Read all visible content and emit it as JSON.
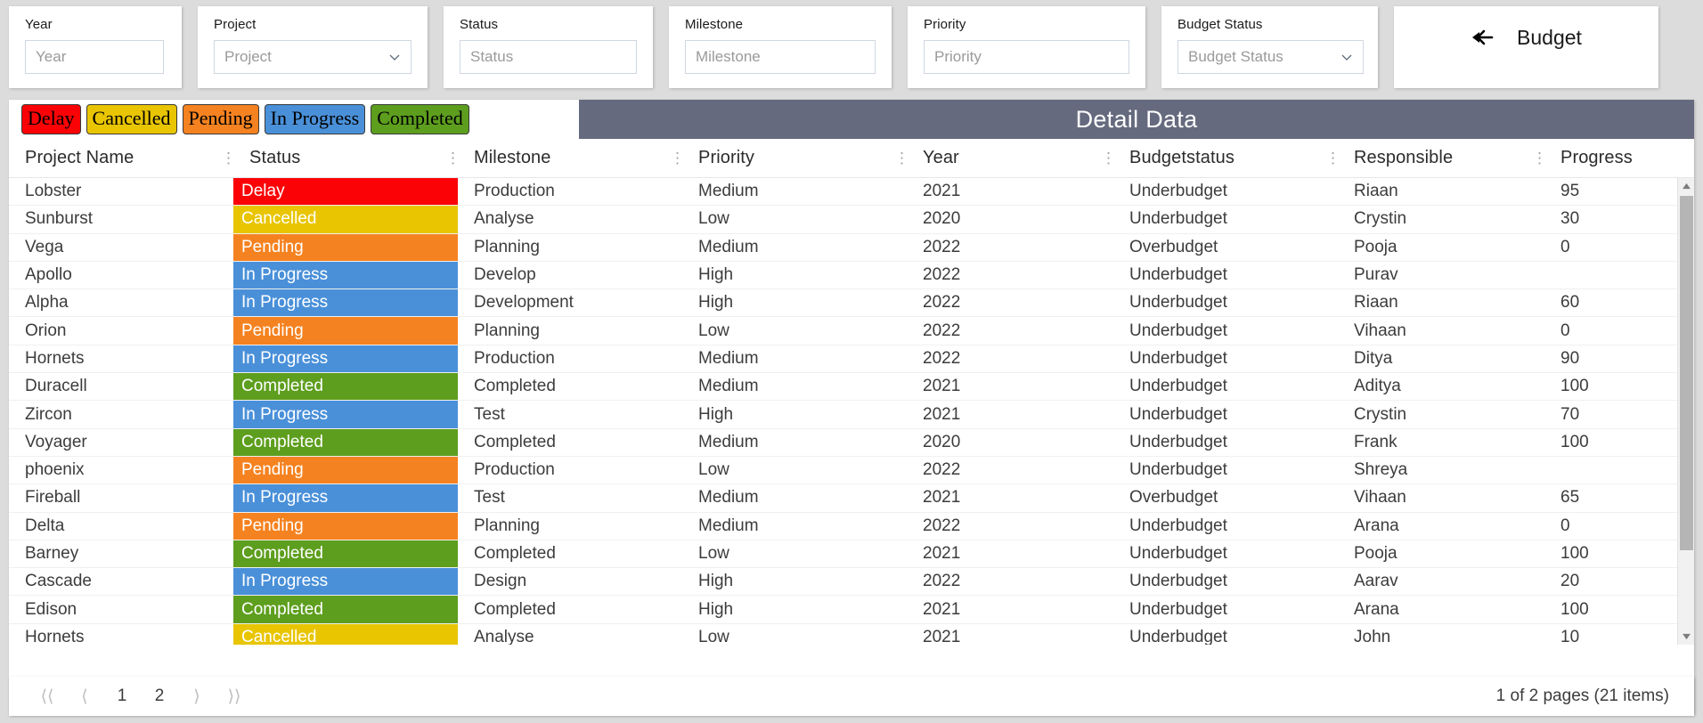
{
  "filters": [
    {
      "id": "year",
      "label": "Year",
      "placeholder": "Year",
      "value": "",
      "type": "text"
    },
    {
      "id": "project",
      "label": "Project",
      "placeholder": "Project",
      "value": "",
      "type": "select"
    },
    {
      "id": "status",
      "label": "Status",
      "placeholder": "Status",
      "value": "",
      "type": "text"
    },
    {
      "id": "milestone",
      "label": "Milestone",
      "placeholder": "Milestone",
      "value": "",
      "type": "text"
    },
    {
      "id": "priority",
      "label": "Priority",
      "placeholder": "Priority",
      "value": "",
      "type": "text"
    },
    {
      "id": "budgetstatus",
      "label": "Budget Status",
      "placeholder": "Budget Status",
      "value": "",
      "type": "select"
    }
  ],
  "budget_button": {
    "label": "Budget",
    "icon": "arrow-left-icon"
  },
  "legend": [
    {
      "label": "Delay",
      "color": "#fb0306"
    },
    {
      "label": "Cancelled",
      "color": "#e8c500"
    },
    {
      "label": "Pending",
      "color": "#f58220"
    },
    {
      "label": "In Progress",
      "color": "#4a90d9"
    },
    {
      "label": "Completed",
      "color": "#5d9e1e"
    }
  ],
  "detail_title": "Detail Data",
  "grid": {
    "columns": [
      "Project Name",
      "Status",
      "Milestone",
      "Priority",
      "Year",
      "Budgetstatus",
      "Responsible",
      "Progress"
    ],
    "rows": [
      {
        "project": "Lobster",
        "status": "Delay",
        "milestone": "Production",
        "priority": "Medium",
        "year": "2021",
        "budgetstatus": "Underbudget",
        "responsible": "Riaan",
        "progress": "95"
      },
      {
        "project": "Sunburst",
        "status": "Cancelled",
        "milestone": "Analyse",
        "priority": "Low",
        "year": "2020",
        "budgetstatus": "Underbudget",
        "responsible": "Crystin",
        "progress": "30"
      },
      {
        "project": "Vega",
        "status": "Pending",
        "milestone": "Planning",
        "priority": "Medium",
        "year": "2022",
        "budgetstatus": "Overbudget",
        "responsible": "Pooja",
        "progress": "0"
      },
      {
        "project": "Apollo",
        "status": "In Progress",
        "milestone": "Develop",
        "priority": "High",
        "year": "2022",
        "budgetstatus": "Underbudget",
        "responsible": "Purav",
        "progress": ""
      },
      {
        "project": "Alpha",
        "status": "In Progress",
        "milestone": "Development",
        "priority": "High",
        "year": "2022",
        "budgetstatus": "Underbudget",
        "responsible": "Riaan",
        "progress": "60"
      },
      {
        "project": "Orion",
        "status": "Pending",
        "milestone": "Planning",
        "priority": "Low",
        "year": "2022",
        "budgetstatus": "Underbudget",
        "responsible": "Vihaan",
        "progress": "0"
      },
      {
        "project": "Hornets",
        "status": "In Progress",
        "milestone": "Production",
        "priority": "Medium",
        "year": "2022",
        "budgetstatus": "Underbudget",
        "responsible": "Ditya",
        "progress": "90"
      },
      {
        "project": "Duracell",
        "status": "Completed",
        "milestone": "Completed",
        "priority": "Medium",
        "year": "2021",
        "budgetstatus": "Underbudget",
        "responsible": "Aditya",
        "progress": "100"
      },
      {
        "project": "Zircon",
        "status": "In Progress",
        "milestone": "Test",
        "priority": "High",
        "year": "2021",
        "budgetstatus": "Underbudget",
        "responsible": "Crystin",
        "progress": "70"
      },
      {
        "project": "Voyager",
        "status": "Completed",
        "milestone": "Completed",
        "priority": "Medium",
        "year": "2020",
        "budgetstatus": "Underbudget",
        "responsible": "Frank",
        "progress": "100"
      },
      {
        "project": "phoenix",
        "status": "Pending",
        "milestone": "Production",
        "priority": "Low",
        "year": "2022",
        "budgetstatus": "Underbudget",
        "responsible": "Shreya",
        "progress": ""
      },
      {
        "project": "Fireball",
        "status": "In Progress",
        "milestone": "Test",
        "priority": "Medium",
        "year": "2021",
        "budgetstatus": "Overbudget",
        "responsible": "Vihaan",
        "progress": "65"
      },
      {
        "project": "Delta",
        "status": "Pending",
        "milestone": "Planning",
        "priority": "Medium",
        "year": "2022",
        "budgetstatus": "Underbudget",
        "responsible": "Arana",
        "progress": "0"
      },
      {
        "project": "Barney",
        "status": "Completed",
        "milestone": "Completed",
        "priority": "Low",
        "year": "2021",
        "budgetstatus": "Underbudget",
        "responsible": "Pooja",
        "progress": "100"
      },
      {
        "project": "Cascade",
        "status": "In Progress",
        "milestone": "Design",
        "priority": "High",
        "year": "2022",
        "budgetstatus": "Underbudget",
        "responsible": "Aarav",
        "progress": "20"
      },
      {
        "project": "Edison",
        "status": "Completed",
        "milestone": "Completed",
        "priority": "High",
        "year": "2021",
        "budgetstatus": "Underbudget",
        "responsible": "Arana",
        "progress": "100"
      },
      {
        "project": "Hornets",
        "status": "Cancelled",
        "milestone": "Analyse",
        "priority": "Low",
        "year": "2021",
        "budgetstatus": "Underbudget",
        "responsible": "John",
        "progress": "10"
      }
    ]
  },
  "pager": {
    "first": "⟨⟨",
    "prev": "⟨",
    "pages": [
      "1",
      "2"
    ],
    "next": "⟩",
    "last": "⟩⟩",
    "summary": "1 of 2 pages (21 items)"
  }
}
